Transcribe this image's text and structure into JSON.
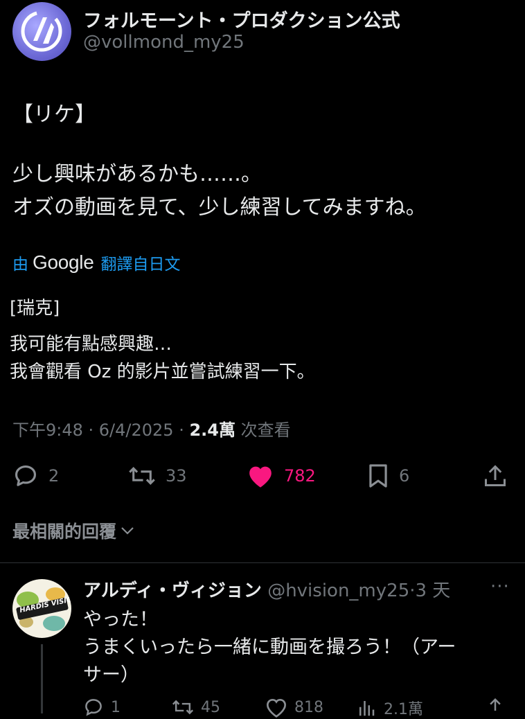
{
  "author": {
    "name": "フォルモーント・プロダクション公式",
    "handle": "@vollmond_my25"
  },
  "tweet": {
    "lines": [
      "【リケ】",
      "少し興味があるかも……。",
      "オズの動画を見て、少し練習してみますね。"
    ]
  },
  "translation": {
    "by_prefix": "由",
    "engine": "Google",
    "by_suffix": "翻譯自日文",
    "lines": [
      "[瑞克]",
      "我可能有點感興趣…",
      "我會觀看 Oz 的影片並嘗試練習一下。"
    ]
  },
  "meta": {
    "time": "下午9:48 · 6/4/2025 · ",
    "views": "2.4萬",
    "views_label": " 次查看"
  },
  "actions": {
    "reply_count": "2",
    "retweet_count": "33",
    "like_count": "782",
    "bookmark_count": "6",
    "like_color": "#f91880"
  },
  "sort": {
    "label": "最相關的回覆"
  },
  "reply": {
    "name": "アルディ・ヴィジョン",
    "handle": "@hvision_my25",
    "time": "·3 天",
    "more": "···",
    "lines": [
      "やった！",
      "うまくいったら一緒に動画を撮ろう！（アー",
      "サー）"
    ],
    "avatar_text": "HARDIS VISION",
    "actions": {
      "reply_count": "1",
      "retweet_count": "45",
      "like_count": "818",
      "views_count": "2.1萬"
    }
  }
}
